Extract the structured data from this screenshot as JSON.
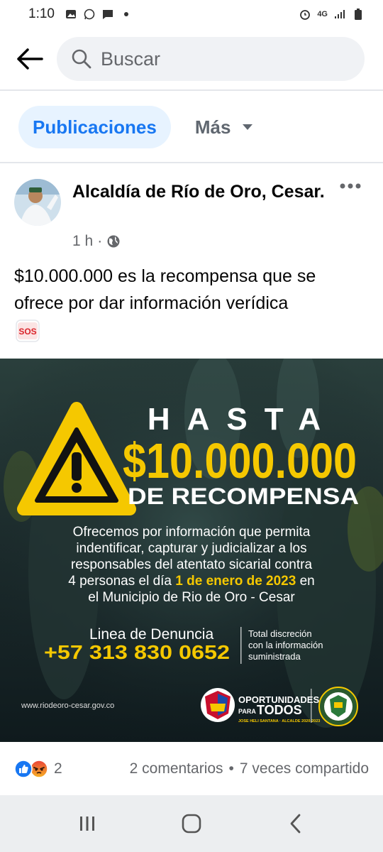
{
  "status_bar": {
    "time": "1:10",
    "network": "4G"
  },
  "header": {
    "search_placeholder": "Buscar"
  },
  "tabs": {
    "active": "Publicaciones",
    "more": "Más"
  },
  "post": {
    "page_name": "Alcaldía de Río de Oro, Cesar.",
    "time_ago": "1 h",
    "meta_separator": "·",
    "text": "$10.000.000 es la recompensa que se ofrece por dar información verídica",
    "sos_label": "SOS",
    "image": {
      "headline": "HASTA",
      "amount": "$10.000.000",
      "subheadline": "DE RECOMPENSA",
      "body_1": "Ofrecemos por información que permita",
      "body_2": "indentificar, capturar y judicializar a los",
      "body_3": "responsables del atentato sicarial contra",
      "body_4a": "4 personas el día ",
      "body_4b": "1 de enero de 2023",
      "body_4c": " en",
      "body_5": "el Municipio de Rio de Oro - Cesar",
      "hotline_label": "Linea de Denuncia",
      "hotline_number": "+57 313 830 0652",
      "discretion_1": "Total discreción",
      "discretion_2": "con la información",
      "discretion_3": "suministrada",
      "website": "www.riodeoro-cesar.gov.co",
      "logo_line_1": "OPORTUNIDADES",
      "logo_line_2": "PARA",
      "logo_line_3": "TODOS",
      "logo_tagline": "JOSE HELI SANTANA · ALCALDE 2020-2023"
    },
    "reaction_count": "2",
    "comments": "2 comentarios",
    "separator": "•",
    "shares": "7 veces compartido"
  },
  "colors": {
    "accent": "#1877f2",
    "accent_bg": "#e7f3ff",
    "poster_yellow": "#f5c800",
    "poster_bg": "#1b2a2a"
  },
  "icons": [
    "back-arrow-icon",
    "search-icon",
    "dropdown-caret-icon",
    "more-options-icon",
    "globe-icon",
    "warning-triangle-icon",
    "like-icon",
    "angry-icon",
    "recents-icon",
    "home-icon",
    "back-nav-icon"
  ]
}
